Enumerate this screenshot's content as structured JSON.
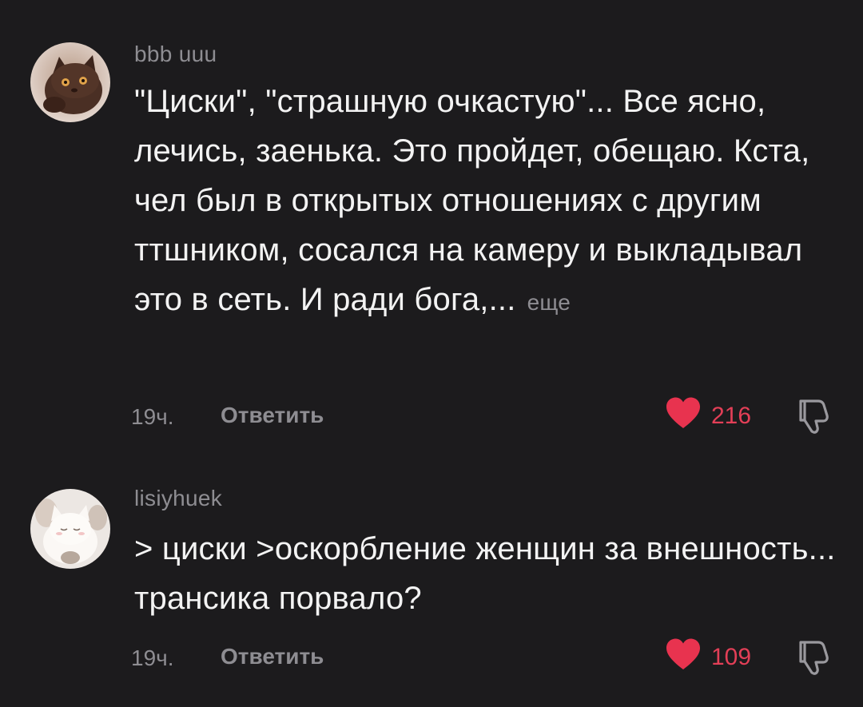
{
  "comments": [
    {
      "username": "bbb uuu",
      "text": "\"Циски\", \"страшную очкастую\"... Все ясно, лечись, заенька. Это пройдет, обещаю. Кста, чел был в открытых отношениях с другим ттшником, сосался на камеру и выкладывал это в сеть. И ради бога,...",
      "more_label": "еще",
      "time": "19ч.",
      "reply_label": "Ответить",
      "likes": "216",
      "like_color": "#e8334f"
    },
    {
      "username": "lisiyhuek",
      "text": "> циски >оскорбление женщин за внешность... трансика порвало?",
      "time": "19ч.",
      "reply_label": "Ответить",
      "likes": "109",
      "like_color": "#e8334f"
    }
  ],
  "icons": {
    "like": "heart-icon",
    "dislike": "thumbs-down-icon"
  }
}
